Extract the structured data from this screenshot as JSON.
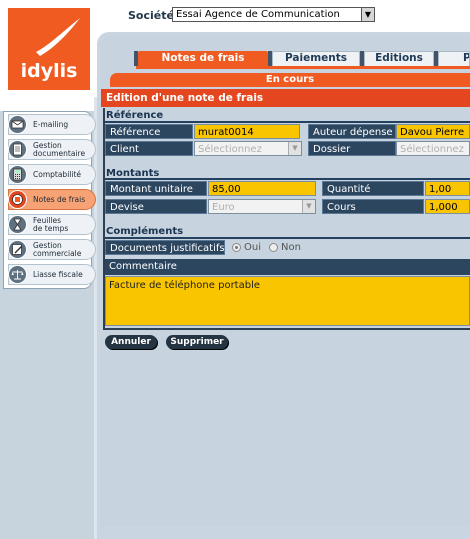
{
  "logo": {
    "text": "idylis",
    "color": "#f05b22"
  },
  "header": {
    "societes_label": "Sociétés",
    "societe_value": "Essai Agence de Communication"
  },
  "sidebar": {
    "items": [
      {
        "label": "E-mailing",
        "icon": "envelope-icon"
      },
      {
        "label": "Gestion\ndocumentaire",
        "icon": "document-icon"
      },
      {
        "label": "Comptabilité",
        "icon": "calculator-icon"
      },
      {
        "label": "Notes de frais",
        "icon": "receipt-icon",
        "active": true
      },
      {
        "label": "Feuilles\nde temps",
        "icon": "hourglass-icon"
      },
      {
        "label": "Gestion\ncommerciale",
        "icon": "pen-icon"
      },
      {
        "label": "Liasse fiscale",
        "icon": "scales-icon"
      }
    ]
  },
  "tabs": [
    {
      "label": "Notes de frais",
      "active": true
    },
    {
      "label": "Paiements"
    },
    {
      "label": "Editions"
    },
    {
      "label": "P"
    }
  ],
  "subtab": {
    "label": "En cours"
  },
  "page_title": "Edition d'une note de frais",
  "sections": {
    "reference": {
      "title": "Référence",
      "reference_label": "Référence",
      "reference_value": "murat0014",
      "auteur_label": "Auteur dépense",
      "auteur_value": "Davou Pierre",
      "client_label": "Client",
      "client_value": "Sélectionnez",
      "dossier_label": "Dossier",
      "dossier_value": "Sélectionnez"
    },
    "montants": {
      "title": "Montants",
      "montant_label": "Montant unitaire",
      "montant_value": "85,00",
      "quantite_label": "Quantité",
      "quantite_value": "1,00",
      "devise_label": "Devise",
      "devise_value": "Euro",
      "cours_label": "Cours",
      "cours_value": "1,000"
    },
    "complements": {
      "title": "Compléments",
      "justificatifs_label": "Documents justificatifs",
      "oui_label": "Oui",
      "non_label": "Non",
      "commentaire_label": "Commentaire",
      "commentaire_value": "Facture de téléphone portable"
    }
  },
  "buttons": {
    "annuler": "Annuler",
    "supprimer": "Supprimer"
  },
  "colors": {
    "accent": "#f05b22",
    "title_bar": "#e4471f",
    "field": "#f9c400",
    "label": "#2d4660"
  }
}
